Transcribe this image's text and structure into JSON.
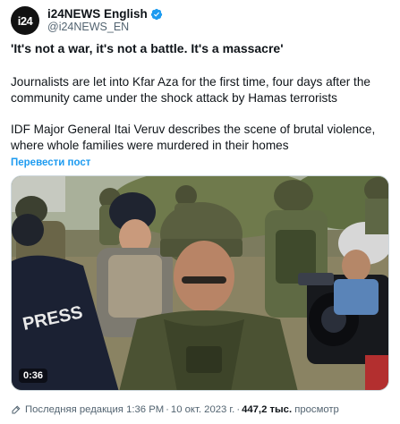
{
  "account": {
    "avatar_text": "i24",
    "display_name": "i24NEWS English",
    "handle": "@i24NEWS_EN",
    "verified_color": "#1d9bf0"
  },
  "post": {
    "headline": "'It's not a war, it's not a battle. It's a massacre'",
    "paragraph1": "Journalists are let into Kfar Aza for the first time, four days after the community came under the shock attack by Hamas terrorists",
    "paragraph2": "IDF Major General Itai Veruv describes the scene of brutal violence, where whole families were murdered in their homes",
    "translate_label": "Перевести пост"
  },
  "media": {
    "type": "video",
    "duration": "0:36",
    "vest_text": "PRESS"
  },
  "footer": {
    "edited_label": "Последняя редакция",
    "time": "1:36 PM",
    "date": "10 окт. 2023 г.",
    "separator": "·",
    "views_count": "447,2 тыс.",
    "views_label": "просмотр"
  },
  "colors": {
    "link": "#1d9bf0",
    "secondary_text": "#536471",
    "primary_text": "#0f1419"
  }
}
